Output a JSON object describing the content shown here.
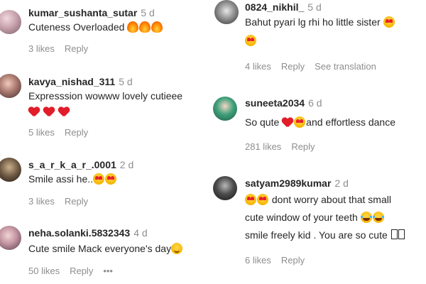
{
  "left": [
    {
      "username": "kumar_sushanta_sutar",
      "time": "5 d",
      "lines": [
        "Cuteness Overloaded"
      ],
      "likes": "3 likes",
      "reply": "Reply"
    },
    {
      "username": "kavya_nishad_311",
      "time": "5 d",
      "lines": [
        "Expresssion wowww lovely cutieee"
      ],
      "likes": "5 likes",
      "reply": "Reply"
    },
    {
      "username": "s_a_r_k_a_r_.0001",
      "time": "2 d",
      "lines": [
        "Smile assi he.."
      ],
      "likes": "3 likes",
      "reply": "Reply"
    },
    {
      "username": "neha.solanki.5832343",
      "time": "4 d",
      "lines": [
        "Cute smile Mack everyone's day"
      ],
      "likes": "50 likes",
      "reply": "Reply",
      "more": "•••"
    }
  ],
  "right": [
    {
      "username": "0824_nikhil_",
      "time": "5 d",
      "lines": [
        "Bahut pyari lg rhi ho little sister"
      ],
      "likes": "4 likes",
      "reply": "Reply",
      "translation": "See translation"
    },
    {
      "username": "suneeta2034",
      "time": "6 d",
      "lines": [
        "So qute",
        "and effortless dance"
      ],
      "likes": "281 likes",
      "reply": "Reply"
    },
    {
      "username": "satyam2989kumar",
      "time": "2 d",
      "lines": [
        "dont worry about that small",
        "cute window of your teeth",
        "smile freely kid . You are so cute"
      ],
      "likes": "6 likes",
      "reply": "Reply"
    }
  ],
  "colors": {
    "text": "#262626",
    "muted": "#8e8e8e",
    "background": "#ffffff"
  },
  "emojis": {
    "fire": "fire-emoji",
    "heart": "red-heart-emoji",
    "hearteyes": "heart-eyes-emoji",
    "smile": "smiling-face-emoji",
    "laugh": "tears-of-joy-emoji"
  }
}
